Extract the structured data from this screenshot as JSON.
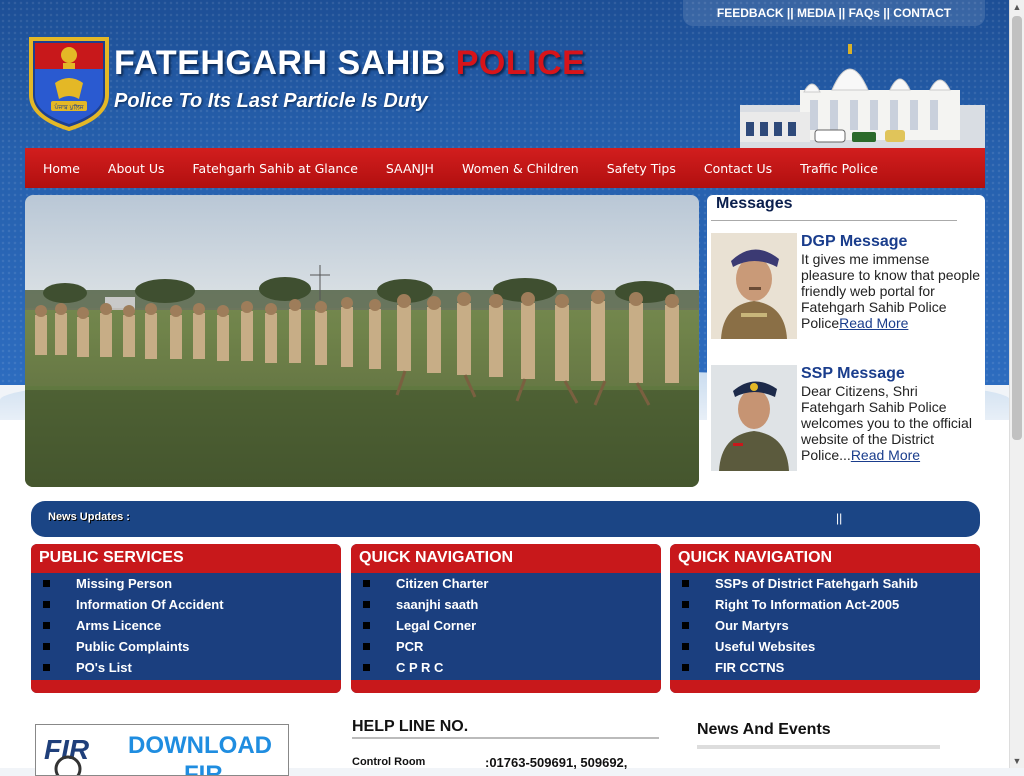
{
  "header": {
    "top_links": "FEEDBACK || MEDIA || FAQs || CONTACT",
    "title_main": "FATEHGARH SAHIB ",
    "title_accent": "POLICE",
    "tagline": "Police To Its Last Particle Is Duty",
    "emblem_text": "ਪੰਜਾਬ ਪੁਲਿਸ"
  },
  "nav": {
    "items": [
      "Home",
      "About Us",
      "Fatehgarh Sahib at Glance",
      "SAANJH",
      "Women & Children",
      "Safety Tips",
      "Contact Us",
      "Traffic Police"
    ]
  },
  "messages": {
    "title": "Messages",
    "dgp": {
      "title": "DGP Message",
      "text": "It gives me immense pleasure to know that people friendly web portal for Fatehgarh Sahib Police Police",
      "link": "Read More"
    },
    "ssp": {
      "title": "SSP Message",
      "text": "Dear Citizens, Shri Fatehgarh Sahib Police welcomes you to the official website of the District Police...",
      "link": "Read More"
    }
  },
  "news": {
    "label": "News Updates  :",
    "separator": "||"
  },
  "boxes": {
    "public_services": {
      "title": "PUBLIC SERVICES",
      "items": [
        "Missing Person",
        "Information Of Accident",
        "Arms Licence",
        "Public Complaints",
        "PO's List"
      ]
    },
    "quick_nav_1": {
      "title": "QUICK NAVIGATION",
      "items": [
        "Citizen Charter",
        "saanjhi saath",
        "Legal Corner",
        "PCR",
        "C P R C"
      ]
    },
    "quick_nav_2": {
      "title": "QUICK NAVIGATION",
      "items": [
        "SSPs of District Fatehgarh Sahib",
        "Right To Information Act-2005",
        "Our Martyrs",
        "Useful Websites",
        "FIR CCTNS"
      ]
    }
  },
  "bottom": {
    "fir_download": "DOWNLOAD",
    "fir_download2": "FIR",
    "fir_logo": "FIR",
    "helpline_title": "HELP LINE NO.",
    "helpline_label": "Control Room",
    "helpline_value": ":01763-509691, 509692,",
    "events_title": "News And Events"
  },
  "colors": {
    "nav_red": "#c8181b",
    "box_blue": "#1b3f7f",
    "news_blue": "#1b4585",
    "header_blue": "#2660ad",
    "title_red": "#d7141a",
    "link_blue": "#1a3d8c"
  }
}
